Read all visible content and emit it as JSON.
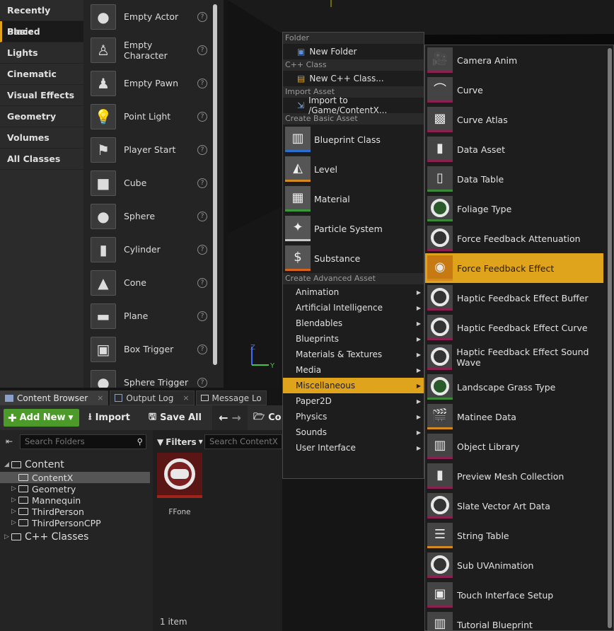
{
  "place_panel": {
    "categories": [
      "Recently Placed",
      "Basic",
      "Lights",
      "Cinematic",
      "Visual Effects",
      "Geometry",
      "Volumes",
      "All Classes"
    ],
    "active_category": "Basic",
    "actors": [
      "Empty Actor",
      "Empty Character",
      "Empty Pawn",
      "Point Light",
      "Player Start",
      "Cube",
      "Sphere",
      "Cylinder",
      "Cone",
      "Plane",
      "Box Trigger",
      "Sphere Trigger"
    ],
    "help_glyph": "?"
  },
  "viewport": {
    "gizmo_z": "Z",
    "gizmo_y": "Y"
  },
  "tabs": [
    {
      "label": "Content Browser",
      "close": "×"
    },
    {
      "label": "Output Log",
      "close": "×"
    },
    {
      "label": "Message Lo",
      "close": ""
    }
  ],
  "toolbar": {
    "add_new": "Add New",
    "import": "Import",
    "save_all": "Save All",
    "path_partial": "Co"
  },
  "folders": {
    "search_placeholder": "Search Folders",
    "tree": [
      {
        "label": "Content",
        "level": 0,
        "expanded": true
      },
      {
        "label": "ContentX",
        "level": 1,
        "selected": true
      },
      {
        "label": "Geometry",
        "level": 1
      },
      {
        "label": "Mannequin",
        "level": 1
      },
      {
        "label": "ThirdPerson",
        "level": 1
      },
      {
        "label": "ThirdPersonCPP",
        "level": 1
      },
      {
        "label": "C++ Classes",
        "level": 0
      }
    ]
  },
  "assets": {
    "filters": "Filters",
    "search_placeholder": "Search ContentX",
    "items": [
      {
        "name": "FFone"
      }
    ],
    "count": "1 item"
  },
  "menu1": {
    "folder_header": "Folder",
    "new_folder": "New Folder",
    "cpp_header": "C++ Class",
    "new_cpp": "New C++ Class...",
    "import_header": "Import Asset",
    "import_to": "Import to /Game/ContentX...",
    "basic_header": "Create Basic Asset",
    "basic": [
      "Blueprint Class",
      "Level",
      "Material",
      "Particle System",
      "Substance"
    ],
    "advanced_header": "Create Advanced Asset",
    "advanced": [
      "Animation",
      "Artificial Intelligence",
      "Blendables",
      "Blueprints",
      "Materials & Textures",
      "Media",
      "Miscellaneous",
      "Paper2D",
      "Physics",
      "Sounds",
      "User Interface"
    ],
    "highlighted": "Miscellaneous"
  },
  "menu2": {
    "items": [
      "Camera Anim",
      "Curve",
      "Curve Atlas",
      "Data Asset",
      "Data Table",
      "Foliage Type",
      "Force Feedback Attenuation",
      "Force Feedback Effect",
      "Haptic Feedback Effect Buffer",
      "Haptic Feedback Effect Curve",
      "Haptic Feedback Effect Sound Wave",
      "Landscape Grass Type",
      "Matinee Data",
      "Object Library",
      "Preview Mesh Collection",
      "Slate Vector Art Data",
      "String Table",
      "Sub UVAnimation",
      "Touch Interface Setup",
      "Tutorial Blueprint"
    ],
    "highlighted": "Force Feedback Effect"
  },
  "colors": {
    "accent": "#e0a31c",
    "add_new_green": "#4c9a2a"
  }
}
